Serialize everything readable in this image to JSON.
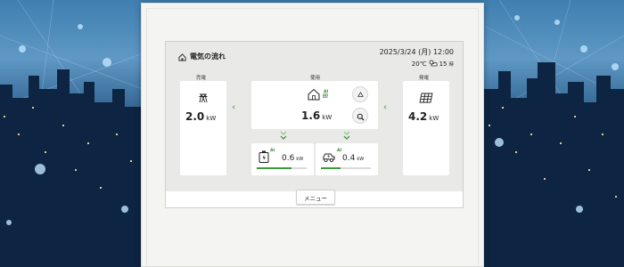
{
  "header": {
    "title": "電気の流れ",
    "date": "2025/3/24",
    "weekday": "(月)",
    "time": "12:00",
    "temperature": "20℃",
    "forecast_value": "15",
    "forecast_unit": "時"
  },
  "sell": {
    "label": "売電",
    "value": "2.0",
    "unit": "kW"
  },
  "use": {
    "label": "使用",
    "value": "1.6",
    "unit": "kW",
    "ai_badge": "AI"
  },
  "generate": {
    "label": "発電",
    "value": "4.2",
    "unit": "kW"
  },
  "battery": {
    "value": "0.6",
    "unit": "kW",
    "ai_badge": "AI",
    "level": 0.7
  },
  "ev": {
    "value": "0.4",
    "unit": "kW",
    "ai_badge": "AI",
    "level": 0.4
  },
  "menu": {
    "label": "メニュー"
  },
  "colors": {
    "accent": "#3a9a3a",
    "panel": "#ffffff",
    "screen_bg": "#e9e9e7"
  },
  "icons": {
    "home": "home-icon",
    "transmission": "power-tower-icon",
    "solar": "solar-panel-icon",
    "battery": "battery-icon",
    "ev": "ev-car-icon",
    "recycle": "recycle-icon",
    "search": "search-icon",
    "weather": "cloudy-sun-icon"
  }
}
